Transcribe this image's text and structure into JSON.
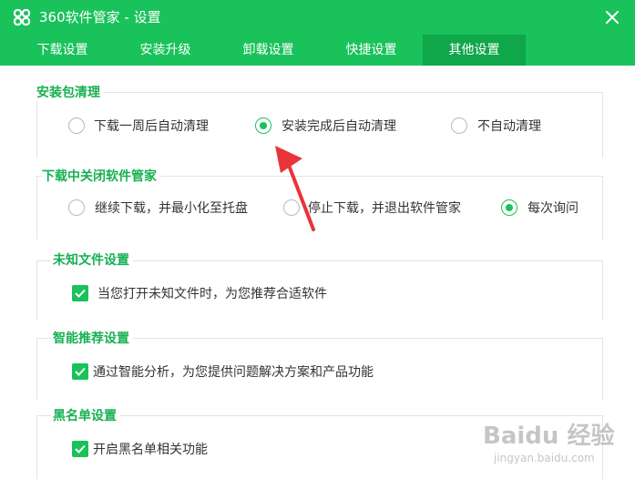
{
  "window": {
    "title": "360软件管家 - 设置",
    "logo_icon": "clover-logo-icon",
    "close_icon": "close-icon"
  },
  "tabs": [
    {
      "label": "下载设置",
      "active": false
    },
    {
      "label": "安装升级",
      "active": false
    },
    {
      "label": "卸载设置",
      "active": false
    },
    {
      "label": "快捷设置",
      "active": false
    },
    {
      "label": "其他设置",
      "active": true
    }
  ],
  "sections": {
    "install_cleanup": {
      "title": "安装包清理",
      "options": [
        {
          "label": "下载一周后自动清理",
          "selected": false
        },
        {
          "label": "安装完成后自动清理",
          "selected": true
        },
        {
          "label": "不自动清理",
          "selected": false
        }
      ]
    },
    "close_during_download": {
      "title": "下载中关闭软件管家",
      "options": [
        {
          "label": "继续下载，并最小化至托盘",
          "selected": false
        },
        {
          "label": "停止下载，并退出软件管家",
          "selected": false
        },
        {
          "label": "每次询问",
          "selected": true
        }
      ]
    },
    "unknown_files": {
      "title": "未知文件设置",
      "checkbox": {
        "label": "当您打开未知文件时，为您推荐合适软件",
        "checked": true
      }
    },
    "smart_recommend": {
      "title": "智能推荐设置",
      "checkbox": {
        "label": "通过智能分析，为您提供问题解决方案和产品功能",
        "checked": true
      }
    },
    "blacklist": {
      "title": "黑名单设置",
      "checkbox": {
        "label": "开启黑名单相关功能",
        "checked": true
      }
    }
  },
  "watermark": {
    "line1": "Baidu 经验",
    "line2": "jingyan.baidu.com"
  },
  "colors": {
    "brand_green": "#19c25a",
    "active_tab": "#10a64a",
    "section_title": "#17b052",
    "annotation_arrow": "#e8343a"
  }
}
